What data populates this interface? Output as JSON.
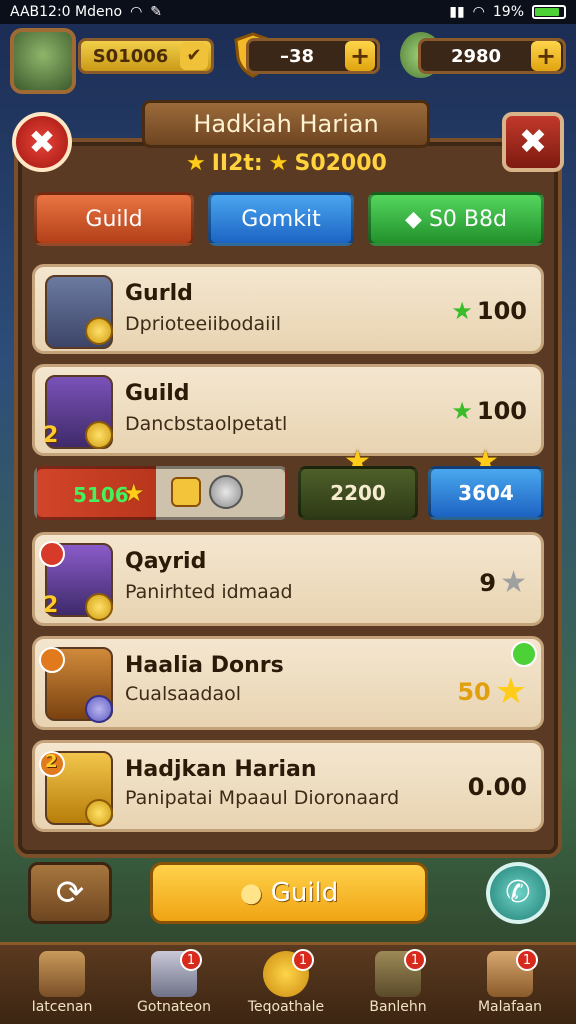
{
  "status_bar": {
    "time": "AAB12:0 Mdeno",
    "battery": "19%"
  },
  "resources": {
    "gold": "S01006",
    "shield": "–38",
    "gems": "2980",
    "plus": "+"
  },
  "panel": {
    "title": "Hadkiah Harian",
    "score_prefix": "II2t:",
    "score_value": "S02000",
    "close_symbol": "✖"
  },
  "tabs": [
    {
      "label": "Guild"
    },
    {
      "label": "Gomkit"
    },
    {
      "label": "S0 B8d"
    }
  ],
  "quests": [
    {
      "title": "Gurld",
      "desc": "Dprioteeiibodaiil",
      "reward": "100"
    },
    {
      "title": "Guild",
      "desc": "Dancbstaolpetatl",
      "reward": "100",
      "badge": "2"
    },
    {
      "title": "Qayrid",
      "desc": "Panirhted idmaad",
      "reward": "9",
      "badge": "2"
    },
    {
      "title": "Haalia Donrs",
      "desc": "Cualsaadaol",
      "reward": "50"
    },
    {
      "title": "Hadjkan Harian",
      "desc": "Panipatai Mpaaul Dioronaard",
      "reward": "0.00",
      "badge": "2"
    }
  ],
  "progress_row": {
    "red_value": "5106",
    "green_value": "2200",
    "blue_value": "3604"
  },
  "bottom": {
    "guild_button": "Guild"
  },
  "nav": [
    {
      "label": "Iatcenan",
      "notif": ""
    },
    {
      "label": "Gotnateon",
      "notif": "1"
    },
    {
      "label": "Teqoathale",
      "notif": "1"
    },
    {
      "label": "Banlehn",
      "notif": "1"
    },
    {
      "label": "Malafaan",
      "notif": "1"
    }
  ]
}
